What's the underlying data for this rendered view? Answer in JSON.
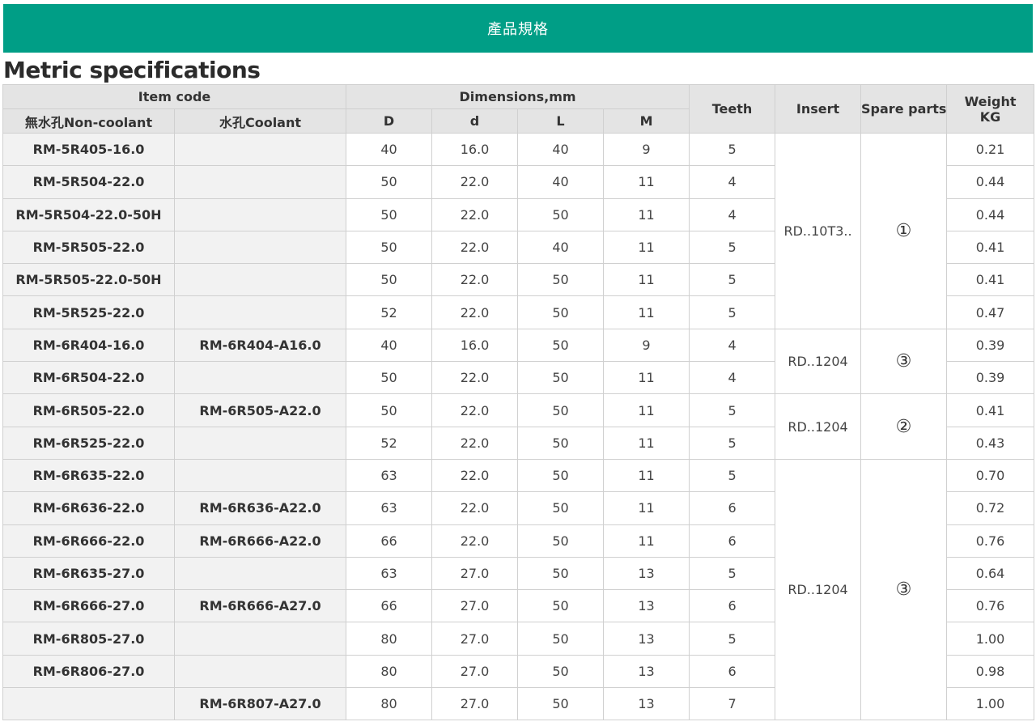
{
  "banner": {
    "title": "產品規格"
  },
  "section_title": "Metric specifications",
  "headers": {
    "item_code": "Item code",
    "dimensions": "Dimensions,mm",
    "teeth": "Teeth",
    "insert": "Insert",
    "spare_parts": "Spare parts",
    "weight": "Weight",
    "weight_unit": "KG",
    "non_coolant": "無水孔Non-coolant",
    "coolant": "水孔Coolant",
    "D": "D",
    "d": "d",
    "L": "L",
    "M": "M"
  },
  "rows": [
    {
      "nc": "RM-5R405-16.0",
      "c": "",
      "D": "40",
      "d": "16.0",
      "L": "40",
      "M": "9",
      "teeth": "5",
      "weight": "0.21"
    },
    {
      "nc": "RM-5R504-22.0",
      "c": "",
      "D": "50",
      "d": "22.0",
      "L": "40",
      "M": "11",
      "teeth": "4",
      "weight": "0.44"
    },
    {
      "nc": "RM-5R504-22.0-50H",
      "c": "",
      "D": "50",
      "d": "22.0",
      "L": "50",
      "M": "11",
      "teeth": "4",
      "weight": "0.44"
    },
    {
      "nc": "RM-5R505-22.0",
      "c": "",
      "D": "50",
      "d": "22.0",
      "L": "40",
      "M": "11",
      "teeth": "5",
      "weight": "0.41"
    },
    {
      "nc": "RM-5R505-22.0-50H",
      "c": "",
      "D": "50",
      "d": "22.0",
      "L": "50",
      "M": "11",
      "teeth": "5",
      "weight": "0.41"
    },
    {
      "nc": "RM-5R525-22.0",
      "c": "",
      "D": "52",
      "d": "22.0",
      "L": "50",
      "M": "11",
      "teeth": "5",
      "weight": "0.47"
    },
    {
      "nc": "RM-6R404-16.0",
      "c": "RM-6R404-A16.0",
      "D": "40",
      "d": "16.0",
      "L": "50",
      "M": "9",
      "teeth": "4",
      "weight": "0.39"
    },
    {
      "nc": "RM-6R504-22.0",
      "c": "",
      "D": "50",
      "d": "22.0",
      "L": "50",
      "M": "11",
      "teeth": "4",
      "weight": "0.39"
    },
    {
      "nc": "RM-6R505-22.0",
      "c": "RM-6R505-A22.0",
      "D": "50",
      "d": "22.0",
      "L": "50",
      "M": "11",
      "teeth": "5",
      "weight": "0.41"
    },
    {
      "nc": "RM-6R525-22.0",
      "c": "",
      "D": "52",
      "d": "22.0",
      "L": "50",
      "M": "11",
      "teeth": "5",
      "weight": "0.43"
    },
    {
      "nc": "RM-6R635-22.0",
      "c": "",
      "D": "63",
      "d": "22.0",
      "L": "50",
      "M": "11",
      "teeth": "5",
      "weight": "0.70"
    },
    {
      "nc": "RM-6R636-22.0",
      "c": "RM-6R636-A22.0",
      "D": "63",
      "d": "22.0",
      "L": "50",
      "M": "11",
      "teeth": "6",
      "weight": "0.72"
    },
    {
      "nc": "RM-6R666-22.0",
      "c": "RM-6R666-A22.0",
      "D": "66",
      "d": "22.0",
      "L": "50",
      "M": "11",
      "teeth": "6",
      "weight": "0.76"
    },
    {
      "nc": "RM-6R635-27.0",
      "c": "",
      "D": "63",
      "d": "27.0",
      "L": "50",
      "M": "13",
      "teeth": "5",
      "weight": "0.64"
    },
    {
      "nc": "RM-6R666-27.0",
      "c": "RM-6R666-A27.0",
      "D": "66",
      "d": "27.0",
      "L": "50",
      "M": "13",
      "teeth": "6",
      "weight": "0.76"
    },
    {
      "nc": "RM-6R805-27.0",
      "c": "",
      "D": "80",
      "d": "27.0",
      "L": "50",
      "M": "13",
      "teeth": "5",
      "weight": "1.00"
    },
    {
      "nc": "RM-6R806-27.0",
      "c": "",
      "D": "80",
      "d": "27.0",
      "L": "50",
      "M": "13",
      "teeth": "6",
      "weight": "0.98"
    },
    {
      "nc": "",
      "c": "RM-6R807-A27.0",
      "D": "80",
      "d": "27.0",
      "L": "50",
      "M": "13",
      "teeth": "7",
      "weight": "1.00"
    }
  ],
  "groups": [
    {
      "insert": "RD..10T3..",
      "spare": "①"
    },
    {
      "insert": "RD..1204",
      "spare": "③"
    },
    {
      "insert": "RD..1204",
      "spare": "②"
    },
    {
      "insert": "RD..1204",
      "spare": "③"
    }
  ]
}
